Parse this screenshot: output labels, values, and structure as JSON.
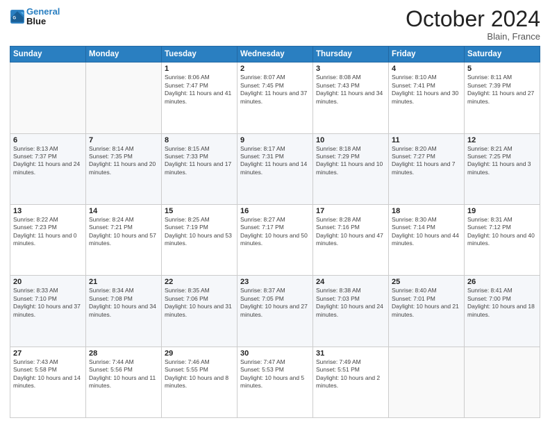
{
  "header": {
    "logo_line1": "General",
    "logo_line2": "Blue",
    "month_title": "October 2024",
    "subtitle": "Blain, France"
  },
  "weekdays": [
    "Sunday",
    "Monday",
    "Tuesday",
    "Wednesday",
    "Thursday",
    "Friday",
    "Saturday"
  ],
  "weeks": [
    [
      {
        "day": "",
        "info": ""
      },
      {
        "day": "",
        "info": ""
      },
      {
        "day": "1",
        "info": "Sunrise: 8:06 AM\nSunset: 7:47 PM\nDaylight: 11 hours and 41 minutes."
      },
      {
        "day": "2",
        "info": "Sunrise: 8:07 AM\nSunset: 7:45 PM\nDaylight: 11 hours and 37 minutes."
      },
      {
        "day": "3",
        "info": "Sunrise: 8:08 AM\nSunset: 7:43 PM\nDaylight: 11 hours and 34 minutes."
      },
      {
        "day": "4",
        "info": "Sunrise: 8:10 AM\nSunset: 7:41 PM\nDaylight: 11 hours and 30 minutes."
      },
      {
        "day": "5",
        "info": "Sunrise: 8:11 AM\nSunset: 7:39 PM\nDaylight: 11 hours and 27 minutes."
      }
    ],
    [
      {
        "day": "6",
        "info": "Sunrise: 8:13 AM\nSunset: 7:37 PM\nDaylight: 11 hours and 24 minutes."
      },
      {
        "day": "7",
        "info": "Sunrise: 8:14 AM\nSunset: 7:35 PM\nDaylight: 11 hours and 20 minutes."
      },
      {
        "day": "8",
        "info": "Sunrise: 8:15 AM\nSunset: 7:33 PM\nDaylight: 11 hours and 17 minutes."
      },
      {
        "day": "9",
        "info": "Sunrise: 8:17 AM\nSunset: 7:31 PM\nDaylight: 11 hours and 14 minutes."
      },
      {
        "day": "10",
        "info": "Sunrise: 8:18 AM\nSunset: 7:29 PM\nDaylight: 11 hours and 10 minutes."
      },
      {
        "day": "11",
        "info": "Sunrise: 8:20 AM\nSunset: 7:27 PM\nDaylight: 11 hours and 7 minutes."
      },
      {
        "day": "12",
        "info": "Sunrise: 8:21 AM\nSunset: 7:25 PM\nDaylight: 11 hours and 3 minutes."
      }
    ],
    [
      {
        "day": "13",
        "info": "Sunrise: 8:22 AM\nSunset: 7:23 PM\nDaylight: 11 hours and 0 minutes."
      },
      {
        "day": "14",
        "info": "Sunrise: 8:24 AM\nSunset: 7:21 PM\nDaylight: 10 hours and 57 minutes."
      },
      {
        "day": "15",
        "info": "Sunrise: 8:25 AM\nSunset: 7:19 PM\nDaylight: 10 hours and 53 minutes."
      },
      {
        "day": "16",
        "info": "Sunrise: 8:27 AM\nSunset: 7:17 PM\nDaylight: 10 hours and 50 minutes."
      },
      {
        "day": "17",
        "info": "Sunrise: 8:28 AM\nSunset: 7:16 PM\nDaylight: 10 hours and 47 minutes."
      },
      {
        "day": "18",
        "info": "Sunrise: 8:30 AM\nSunset: 7:14 PM\nDaylight: 10 hours and 44 minutes."
      },
      {
        "day": "19",
        "info": "Sunrise: 8:31 AM\nSunset: 7:12 PM\nDaylight: 10 hours and 40 minutes."
      }
    ],
    [
      {
        "day": "20",
        "info": "Sunrise: 8:33 AM\nSunset: 7:10 PM\nDaylight: 10 hours and 37 minutes."
      },
      {
        "day": "21",
        "info": "Sunrise: 8:34 AM\nSunset: 7:08 PM\nDaylight: 10 hours and 34 minutes."
      },
      {
        "day": "22",
        "info": "Sunrise: 8:35 AM\nSunset: 7:06 PM\nDaylight: 10 hours and 31 minutes."
      },
      {
        "day": "23",
        "info": "Sunrise: 8:37 AM\nSunset: 7:05 PM\nDaylight: 10 hours and 27 minutes."
      },
      {
        "day": "24",
        "info": "Sunrise: 8:38 AM\nSunset: 7:03 PM\nDaylight: 10 hours and 24 minutes."
      },
      {
        "day": "25",
        "info": "Sunrise: 8:40 AM\nSunset: 7:01 PM\nDaylight: 10 hours and 21 minutes."
      },
      {
        "day": "26",
        "info": "Sunrise: 8:41 AM\nSunset: 7:00 PM\nDaylight: 10 hours and 18 minutes."
      }
    ],
    [
      {
        "day": "27",
        "info": "Sunrise: 7:43 AM\nSunset: 5:58 PM\nDaylight: 10 hours and 14 minutes."
      },
      {
        "day": "28",
        "info": "Sunrise: 7:44 AM\nSunset: 5:56 PM\nDaylight: 10 hours and 11 minutes."
      },
      {
        "day": "29",
        "info": "Sunrise: 7:46 AM\nSunset: 5:55 PM\nDaylight: 10 hours and 8 minutes."
      },
      {
        "day": "30",
        "info": "Sunrise: 7:47 AM\nSunset: 5:53 PM\nDaylight: 10 hours and 5 minutes."
      },
      {
        "day": "31",
        "info": "Sunrise: 7:49 AM\nSunset: 5:51 PM\nDaylight: 10 hours and 2 minutes."
      },
      {
        "day": "",
        "info": ""
      },
      {
        "day": "",
        "info": ""
      }
    ]
  ]
}
